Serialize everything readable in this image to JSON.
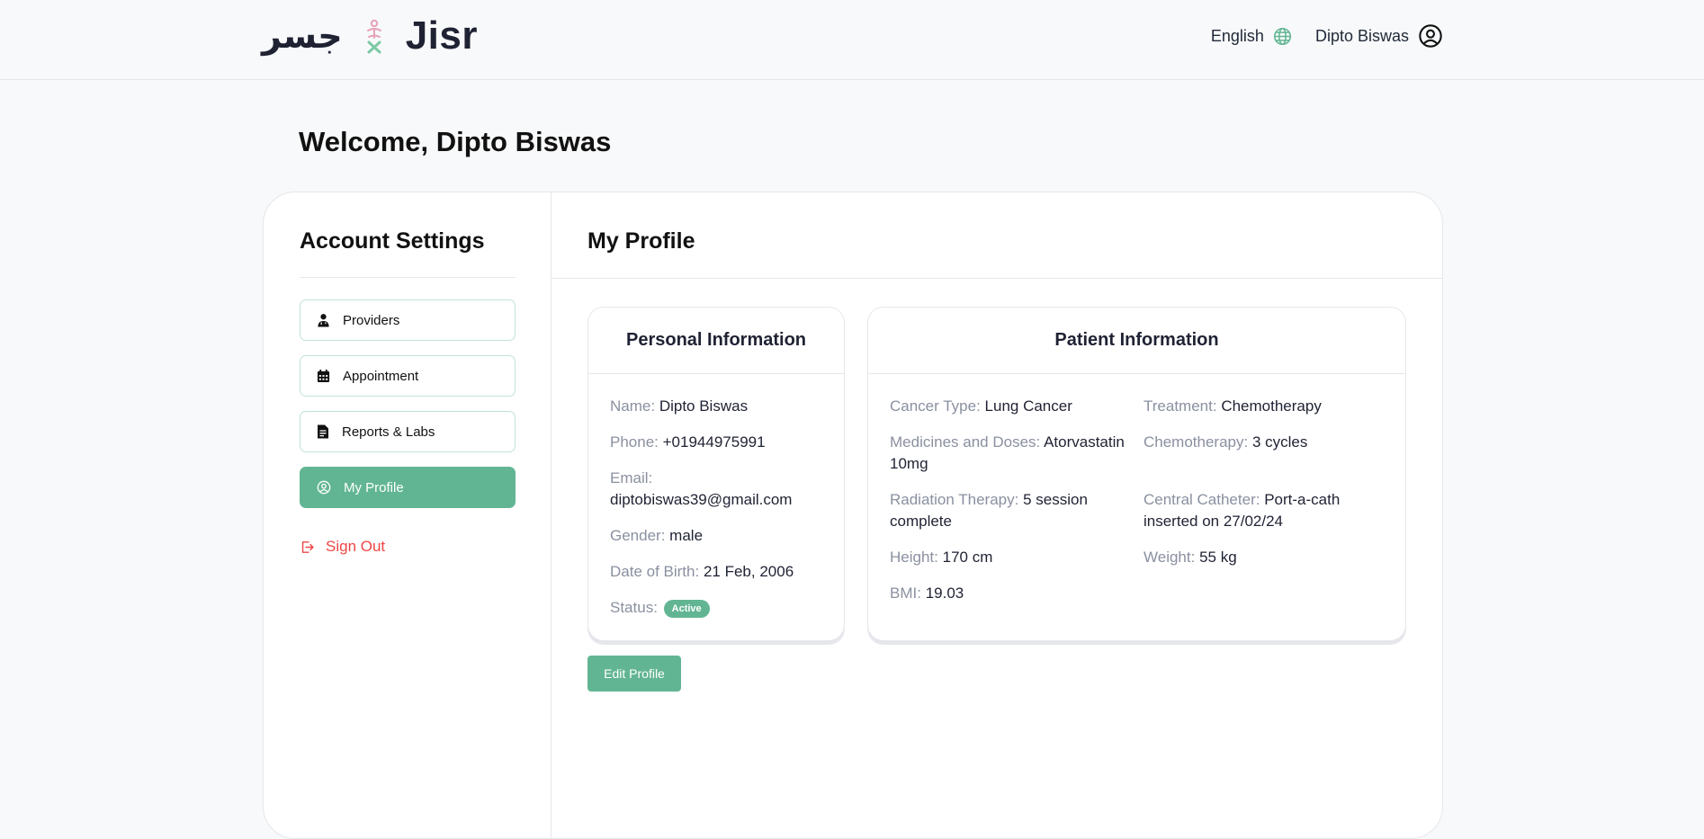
{
  "header": {
    "logo_arabic": "جسر",
    "logo_text": "Jisr",
    "language": "English",
    "user_name": "Dipto Biswas"
  },
  "welcome": "Welcome, Dipto Biswas",
  "sidebar": {
    "title": "Account Settings",
    "items": [
      {
        "label": "Providers",
        "icon": "doctor-icon"
      },
      {
        "label": "Appointment",
        "icon": "calendar-icon"
      },
      {
        "label": "Reports & Labs",
        "icon": "document-icon"
      },
      {
        "label": "My Profile",
        "icon": "user-circle-icon",
        "active": true
      }
    ],
    "sign_out": "Sign Out"
  },
  "main": {
    "title": "My Profile",
    "personal": {
      "title": "Personal Information",
      "name_label": "Name:",
      "name": "Dipto Biswas",
      "phone_label": "Phone:",
      "phone": "+01944975991",
      "email_label": "Email:",
      "email": "diptobiswas39@gmail.com",
      "gender_label": "Gender:",
      "gender": "male",
      "dob_label": "Date of Birth:",
      "dob": "21 Feb, 2006",
      "status_label": "Status:",
      "status": "Active"
    },
    "patient": {
      "title": "Patient Information",
      "cancer_label": "Cancer Type:",
      "cancer": "Lung Cancer",
      "treatment_label": "Treatment:",
      "treatment": "Chemotherapy",
      "medicines_label": "Medicines and Doses:",
      "medicines": "Atorvastatin 10mg",
      "chemo_label": "Chemotherapy:",
      "chemo": "3 cycles",
      "radiation_label": "Radiation Therapy:",
      "radiation": "5 session complete",
      "catheter_label": "Central Catheter:",
      "catheter": "Port-a-cath inserted on 27/02/24",
      "height_label": "Height:",
      "height": "170 cm",
      "weight_label": "Weight:",
      "weight": "55 kg",
      "bmi_label": "BMI:",
      "bmi": "19.03"
    },
    "edit_button": "Edit Profile"
  },
  "colors": {
    "accent": "#62b593",
    "danger": "#ef4444",
    "muted_label": "#8a90a0"
  }
}
